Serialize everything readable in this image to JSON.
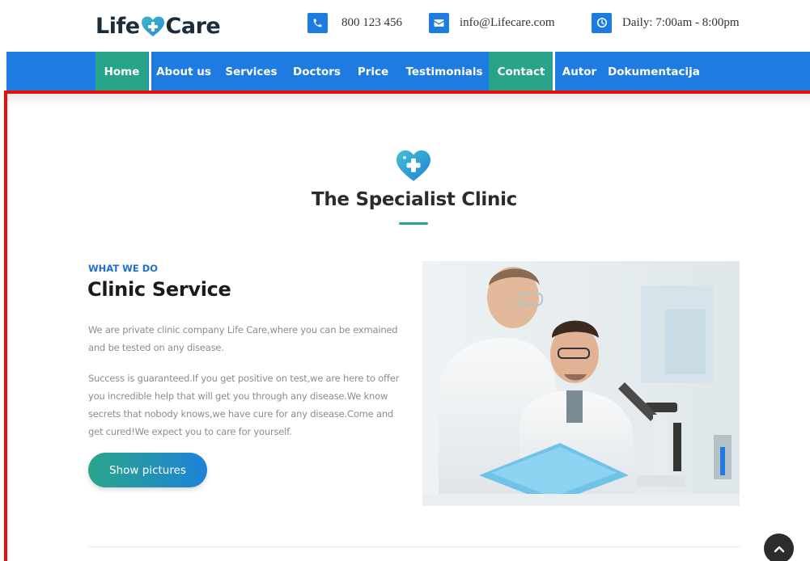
{
  "header": {
    "logo_left": "Life",
    "logo_right": "Care",
    "logo_icon": "heart-plus-icon",
    "phone_icon": "phone-icon",
    "phone": "800 123 456",
    "email_icon": "envelope-icon",
    "email": "info@Lifecare.com",
    "hours_icon": "clock-icon",
    "hours": "Daily: 7:00am - 8:00pm"
  },
  "nav": {
    "items": [
      {
        "label": "Home",
        "active": true
      },
      {
        "label": "About us",
        "active": false
      },
      {
        "label": "Services",
        "active": false
      },
      {
        "label": "Doctors",
        "active": false
      },
      {
        "label": "Price",
        "active": false
      },
      {
        "label": "Testimonials",
        "active": false
      },
      {
        "label": "Contact",
        "active": true
      },
      {
        "label": "Autor",
        "active": false
      },
      {
        "label": "Dokumentacija",
        "active": false
      }
    ]
  },
  "section": {
    "icon": "heart-plus-icon",
    "title": "The Specialist Clinic",
    "kicker": "WHAT WE DO",
    "heading": "Clinic Service",
    "paragraph1": "We are private clinic company Life Care,where you can be exmained and be tested on any disease.",
    "paragraph2": "Success is guaranteed.If you get positive on test,we are here to offer you incredible help that will get you through any disease.We know secrets that nobody knows,we have cure for any disease.Come and get cured!We expect you to care for yourself.",
    "button": "Show pictures",
    "image": "doctors-with-microscope-photo"
  },
  "scroll_top_icon": "chevron-up-icon",
  "colors": {
    "primary_blue": "#1e7be0",
    "accent_green": "#27a48a",
    "highlight_red": "#ee0b0b"
  }
}
